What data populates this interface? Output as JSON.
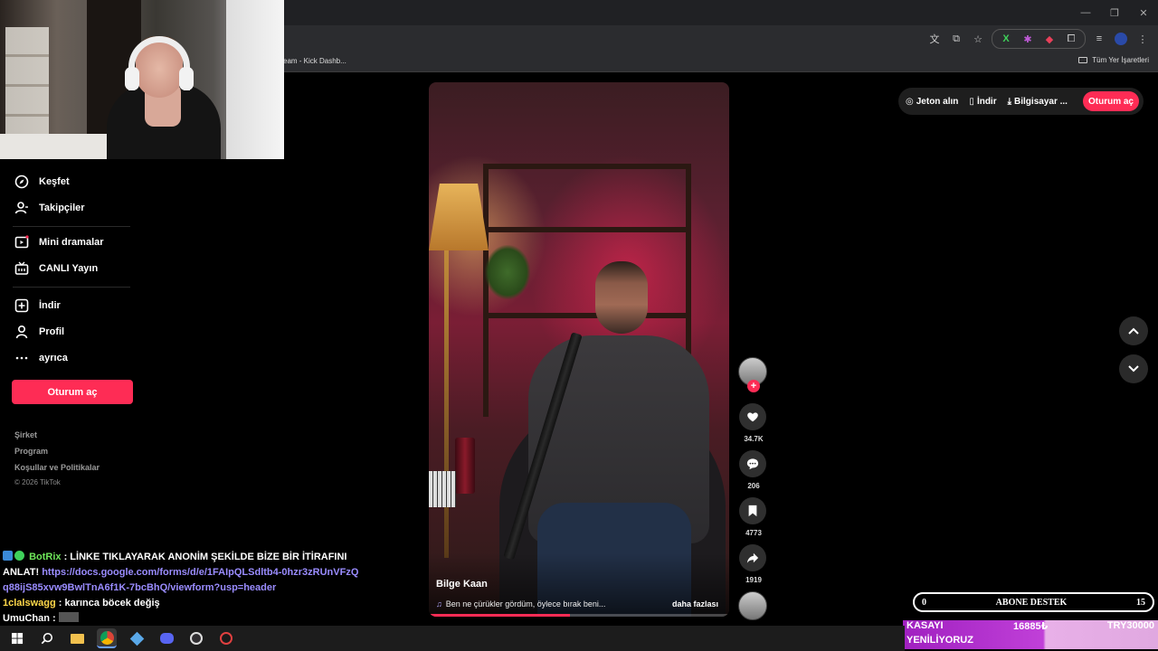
{
  "browser": {
    "bookmark_left": "eam - Kick Dashb...",
    "bookmark_right": "Tüm Yer İşaretleri"
  },
  "sidebar": {
    "items": [
      {
        "label": "Keşfet",
        "icon": "compass-icon"
      },
      {
        "label": "Takipçiler",
        "icon": "user-follow-icon"
      },
      {
        "label": "Mini dramalar",
        "icon": "film-icon"
      },
      {
        "label": "CANLI Yayın",
        "icon": "tv-live-icon"
      },
      {
        "label": "İndir",
        "icon": "download-plus-icon"
      },
      {
        "label": "Profil",
        "icon": "person-icon"
      },
      {
        "label": "ayrıca",
        "icon": "more-dots-icon"
      }
    ],
    "login_label": "Oturum aç",
    "footer": [
      "Şirket",
      "Program",
      "Koşullar ve Politikalar"
    ],
    "copyright": "© 2026 TikTok"
  },
  "header": {
    "coins": "Jeton alın",
    "download": "İndir",
    "computer": "Bilgisayar ...",
    "login": "Oturum aç"
  },
  "video": {
    "author": "Bilge Kaan",
    "caption": "Ben ne çürükler gördüm, öylece bırak beni...",
    "more": "daha fazlası",
    "progress": 0.47
  },
  "actions": {
    "likes": "34.7K",
    "comments": "206",
    "saves": "4773",
    "shares": "1919"
  },
  "chat": {
    "messages": [
      {
        "user": "BotRix",
        "text": "LİNKE TIKLAYARAK ANONİM ŞEKİLDE BİZE BİR İTİRAFINI ANLAT!",
        "link": "https://docs.google.com/forms/d/e/1FAIpQLSdltb4-0hzr3zRUnVFzQq88ijS85xvw9BwlTnA6f1K-7bcBhQ/viewform?usp=header"
      },
      {
        "user": "1clalswagg",
        "text": "karınca böcek değiş"
      },
      {
        "user": "UmuChan",
        "text": ""
      }
    ]
  },
  "widgets": {
    "support_left": "0",
    "support_label": "ABONE DESTEK",
    "support_right": "15",
    "ticker_line1": "KASAYI",
    "ticker_line2": "YENİLİYORUZ",
    "ticker_amount1": "16885₺",
    "ticker_amount2": "TRY30000"
  },
  "colors": {
    "accent": "#fe2c55",
    "bot_user": "#6ee65a",
    "user_yellow": "#ffd84a",
    "link": "#9a8cff"
  }
}
